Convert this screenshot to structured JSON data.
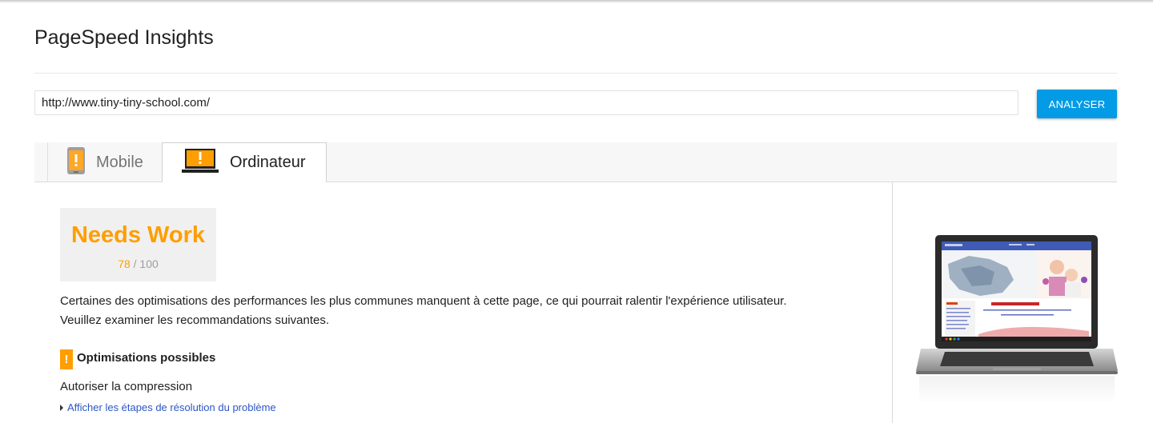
{
  "app": {
    "title": "PageSpeed Insights"
  },
  "search": {
    "url_value": "http://www.tiny-tiny-school.com/",
    "analyze_label": "ANALYSER"
  },
  "tabs": [
    {
      "label": "Mobile",
      "icon": "phone-warning-icon",
      "active": false
    },
    {
      "label": "Ordinateur",
      "icon": "laptop-warning-icon",
      "active": true
    }
  ],
  "score": {
    "label": "Needs Work",
    "value": "78",
    "max": "/ 100"
  },
  "summary": {
    "line1": "Certaines des optimisations des performances les plus communes manquent à cette page, ce qui pourrait ralentir l'expérience utilisateur.",
    "line2": "Veuillez examiner les recommandations suivantes."
  },
  "optimizations": {
    "badge": "!",
    "heading": "Optimisations possibles",
    "items": [
      {
        "title": "Autoriser la compression",
        "link": "Afficher les étapes de résolution du problème"
      }
    ]
  },
  "colors": {
    "accent_orange": "#ff9e00",
    "button_blue": "#039be5",
    "link_blue": "#2a56c6"
  }
}
